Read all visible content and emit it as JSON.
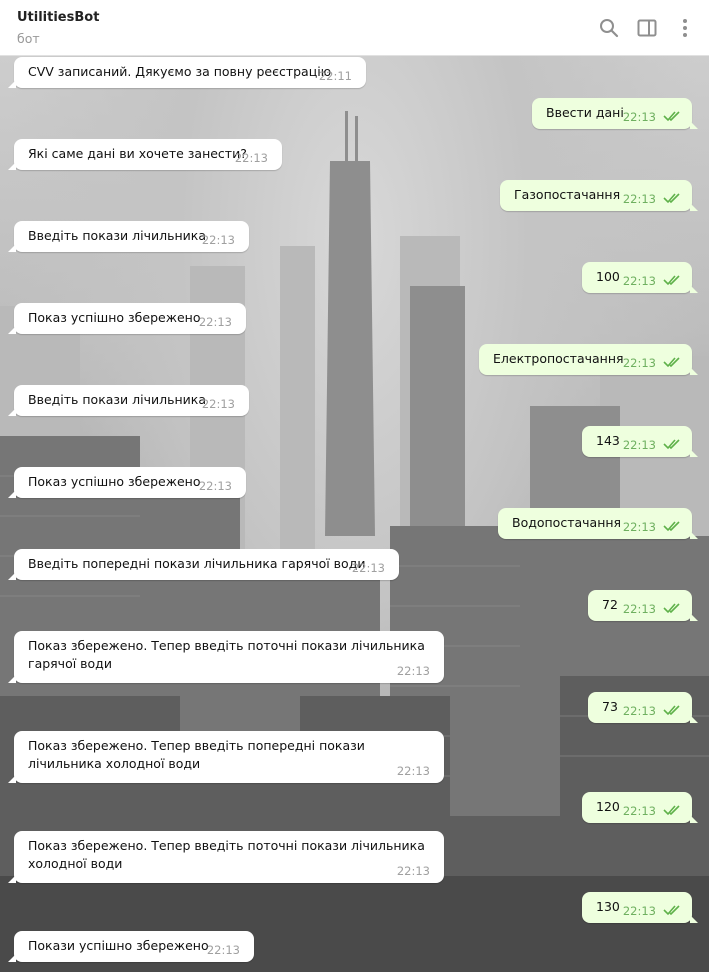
{
  "header": {
    "title": "UtilitiesBot",
    "subtitle": "бот",
    "icons": [
      "search-icon",
      "sidebar-toggle-icon",
      "more-vertical-icon"
    ]
  },
  "colors": {
    "incoming_bubble": "#ffffff",
    "outgoing_bubble": "#eeffde",
    "outgoing_time": "#6fb060",
    "read_check": "#5fb14a"
  },
  "messages": [
    {
      "dir": "in",
      "text": "CVV записаний. Дякуємо за повну реєстрацію",
      "time": "22:11"
    },
    {
      "dir": "out",
      "text": "Ввести дані",
      "time": "22:13",
      "status": "read"
    },
    {
      "dir": "in",
      "text": "Які саме дані ви хочете занести?",
      "time": "22:13"
    },
    {
      "dir": "out",
      "text": "Газопостачання",
      "time": "22:13",
      "status": "read"
    },
    {
      "dir": "in",
      "text": "Введіть покази лічильника",
      "time": "22:13"
    },
    {
      "dir": "out",
      "text": "100",
      "time": "22:13",
      "status": "read"
    },
    {
      "dir": "in",
      "text": "Показ успішно збережено",
      "time": "22:13"
    },
    {
      "dir": "out",
      "text": "Електропостачання",
      "time": "22:13",
      "status": "read"
    },
    {
      "dir": "in",
      "text": "Введіть покази лічильника",
      "time": "22:13"
    },
    {
      "dir": "out",
      "text": "143",
      "time": "22:13",
      "status": "read"
    },
    {
      "dir": "in",
      "text": "Показ успішно збережено",
      "time": "22:13"
    },
    {
      "dir": "out",
      "text": "Водопостачання",
      "time": "22:13",
      "status": "read"
    },
    {
      "dir": "in",
      "text": "Введіть попередні покази лічильника гарячої води",
      "time": "22:13"
    },
    {
      "dir": "out",
      "text": "72",
      "time": "22:13",
      "status": "read"
    },
    {
      "dir": "in",
      "text": "Показ збережено. Тепер введіть поточні покази лічильника гарячої води",
      "time": "22:13"
    },
    {
      "dir": "out",
      "text": "73",
      "time": "22:13",
      "status": "read"
    },
    {
      "dir": "in",
      "text": "Показ збережено. Тепер введіть попередні покази лічильника холодної води",
      "time": "22:13"
    },
    {
      "dir": "out",
      "text": "120",
      "time": "22:13",
      "status": "read"
    },
    {
      "dir": "in",
      "text": "Показ збережено. Тепер введіть поточні покази лічильника холодної води",
      "time": "22:13"
    },
    {
      "dir": "out",
      "text": "130",
      "time": "22:13",
      "status": "read"
    },
    {
      "dir": "in",
      "text": "Покази успішно збережено",
      "time": "22:13"
    }
  ]
}
